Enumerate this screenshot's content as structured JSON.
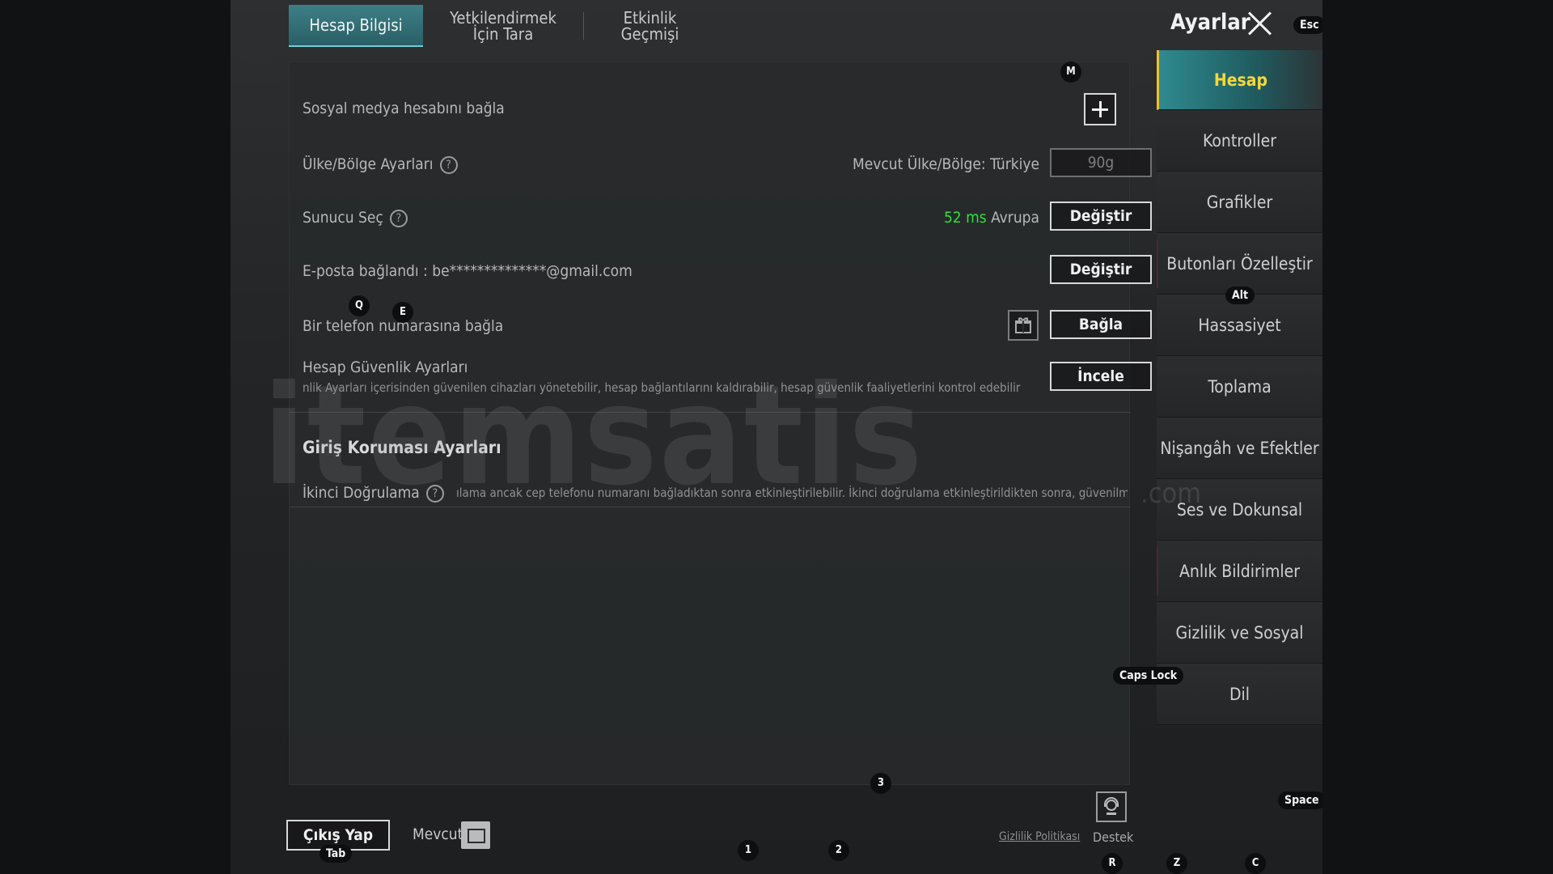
{
  "tabs": [
    {
      "label": "Hesap Bilgisi"
    },
    {
      "label": "Yetkilendirmek İçin Tara"
    },
    {
      "label": "Etkinlik Geçmişi"
    }
  ],
  "header": {
    "title": "Ayarlar"
  },
  "rows": {
    "social": {
      "label": "Sosyal medya hesabını bağla"
    },
    "region": {
      "label": "Ülke/Bölge Ayarları",
      "current": "Mevcut Ülke/Bölge: Türkiye",
      "button": "90g"
    },
    "server": {
      "label": "Sunucu Seç",
      "ping": "52 ms",
      "server_name": "Avrupa",
      "button": "Değiştir"
    },
    "email": {
      "label": "E-posta bağlandı : be**************@gmail.com",
      "button": "Değiştir"
    },
    "phone": {
      "label": "Bir telefon numarasına bağla",
      "button": "Bağla"
    },
    "security": {
      "label": "Hesap Güvenlik Ayarları",
      "desc": "nlik Ayarları içerisinden güvenilen cihazları yönetebilir, hesap bağlantılarını kaldırabilir, hesap güvenlik faaliyetlerini kontrol edebilir ve",
      "button": "İncele"
    },
    "login_section": {
      "title": "Giriş Koruması Ayarları"
    },
    "twofa": {
      "label": "İkinci Doğrulama",
      "desc": "ılama ancak cep telefonu numaranı bağladıktan sonra etkinleştirilebilir. İkinci doğrulama etkinleştirildikten sonra, güvenilme"
    }
  },
  "sidebar": {
    "items": [
      {
        "label": "Hesap"
      },
      {
        "label": "Kontroller"
      },
      {
        "label": "Grafikler"
      },
      {
        "label": "Butonları Özelleştir"
      },
      {
        "label": "Hassasiyet"
      },
      {
        "label": "Toplama"
      },
      {
        "label": "Nişangâh ve Efektler"
      },
      {
        "label": "Ses ve Dokunsal"
      },
      {
        "label": "Anlık Bildirimler"
      },
      {
        "label": "Gizlilik ve Sosyal"
      },
      {
        "label": "Dil"
      }
    ]
  },
  "keyhints": {
    "esc": "Esc",
    "m": "M",
    "q": "Q",
    "e": "E",
    "alt": "Alt",
    "caps": "Caps Lock",
    "three": "3",
    "space": "Space",
    "tab": "Tab",
    "one": "1",
    "two": "2",
    "r": "R",
    "z": "Z",
    "c": "C"
  },
  "footer": {
    "logout": "Çıkış Yap",
    "mevcut": "Mevcut",
    "privacy": "Gizlilik Politikası",
    "support": "Destek"
  },
  "watermark": {
    "text": "itemsatis",
    "sub": ".com"
  },
  "colors": {
    "accent": "#2f8a8f",
    "active_text": "#f7d73c",
    "ping": "#2fe03a"
  }
}
